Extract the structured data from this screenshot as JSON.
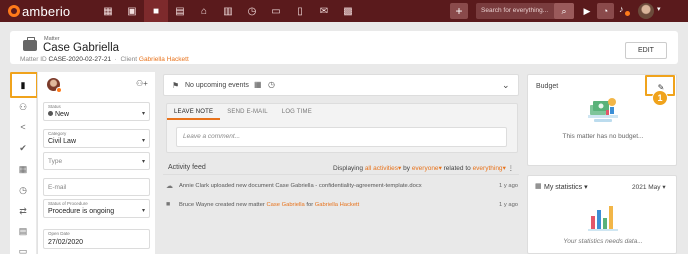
{
  "app": {
    "name": "amberio",
    "search_placeholder": "Search for everything..."
  },
  "header": {
    "type_label": "Matter",
    "title": "Case Gabriella",
    "matter_id_label": "Matter ID",
    "matter_id": "CASE-2020-02-27-21",
    "client_label": "Client",
    "client_name": "Gabriella Hackett",
    "edit_label": "EDIT"
  },
  "details": {
    "status": {
      "label": "Status",
      "value": "New"
    },
    "category": {
      "label": "Category",
      "value": "Civil Law"
    },
    "type": {
      "placeholder": "Type"
    },
    "email": {
      "placeholder": "E-mail"
    },
    "procedure": {
      "label": "Status of Procedure",
      "value": "Procedure is ongoing"
    },
    "open_date": {
      "label": "Open Date",
      "value": "27/02/2020"
    }
  },
  "upcoming": {
    "text": "No upcoming events"
  },
  "note": {
    "tabs": [
      "LEAVE NOTE",
      "SEND E-MAIL",
      "LOG TIME"
    ],
    "comment_placeholder": "Leave a comment..."
  },
  "feed": {
    "title": "Activity feed",
    "filter": {
      "prefix": "Displaying",
      "activities": "all activities",
      "by": "by",
      "who": "everyone",
      "related": "related to",
      "what": "everything"
    },
    "items": [
      {
        "text_a": "Annie Clark uploaded new document Case Gabriella - confidentiality-agreement-template.docx",
        "time": "1 y ago"
      },
      {
        "text_a": "Bruce Wayne created new matter",
        "link1": "Case Gabriella",
        "mid": "for",
        "link2": "Gabriella Hackett",
        "time": "1 y ago"
      }
    ]
  },
  "budget": {
    "title": "Budget",
    "message": "This matter has no budget..."
  },
  "stats": {
    "title": "My statistics",
    "month": "2021 May",
    "message": "Your statistics needs data..."
  },
  "callout": {
    "number": "1"
  },
  "colors": {
    "topbar": "#5a1a1c",
    "accent": "#e8731c",
    "callout": "#f0a31c"
  }
}
